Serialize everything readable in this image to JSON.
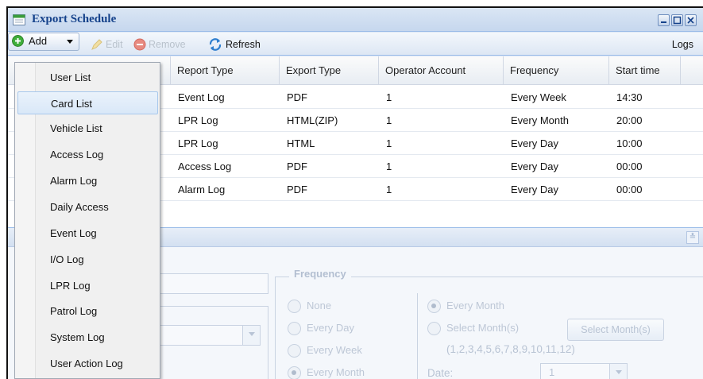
{
  "window": {
    "title": "Export Schedule"
  },
  "toolbar": {
    "add_label": "Add",
    "edit_label": "Edit",
    "remove_label": "Remove",
    "refresh_label": "Refresh",
    "logs_label": "Logs"
  },
  "grid": {
    "columns": [
      "Report Type",
      "Export Type",
      "Operator Account",
      "Frequency",
      "Start time"
    ],
    "rows": [
      [
        "Event Log",
        "PDF",
        "1",
        "Every Week",
        "14:30"
      ],
      [
        "LPR Log",
        "HTML(ZIP)",
        "1",
        "Every Month",
        "20:00"
      ],
      [
        "LPR Log",
        "HTML",
        "1",
        "Every Day",
        "10:00"
      ],
      [
        "Access Log",
        "PDF",
        "1",
        "Every Day",
        "00:00"
      ],
      [
        "Alarm Log",
        "PDF",
        "1",
        "Every Day",
        "00:00"
      ]
    ]
  },
  "form": {
    "frequency_legend": "Frequency",
    "frequency_options": [
      "None",
      "Every Day",
      "Every Week",
      "Every Month"
    ],
    "frequency_selected": "Every Month",
    "month_options": [
      "Every Month",
      "Select Month(s)"
    ],
    "month_selected": "Every Month",
    "months_hint": "(1,2,3,4,5,6,7,8,9,10,11,12)",
    "select_months_button": "Select Month(s)",
    "date_label": "Date:",
    "date_value": "1"
  },
  "add_menu": {
    "items": [
      "User List",
      "Card List",
      "Vehicle List",
      "Access Log",
      "Alarm Log",
      "Daily Access",
      "Event Log",
      "I/O Log",
      "LPR Log",
      "Patrol Log",
      "System Log",
      "User Action Log"
    ],
    "highlighted": "Card List"
  },
  "colors": {
    "title": "#15428b",
    "frame": "#99bbe8",
    "add_icon": "#3fae3a",
    "remove_icon": "#e25b4e",
    "menu_highlight": "#d9e8f8"
  },
  "icons": [
    "schedule-icon",
    "minimize-icon",
    "maximize-icon",
    "close-icon",
    "add-icon",
    "edit-icon",
    "remove-icon",
    "refresh-icon",
    "collapse-icon"
  ]
}
